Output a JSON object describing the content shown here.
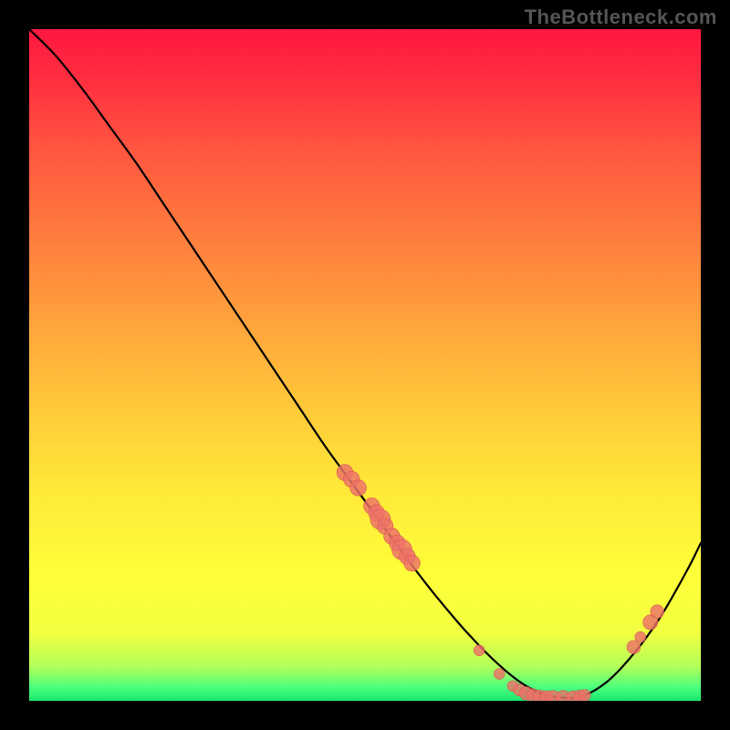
{
  "domain": "Chart",
  "watermark": "TheBottleneck.com",
  "colors": {
    "frame_bg": "#000000",
    "curve_stroke": "#000000",
    "marker_fill": "#ed7169",
    "marker_stroke": "#d85a52",
    "gradient_top": "#ff173f",
    "gradient_mid": "#ffe838",
    "gradient_bottom": "#17e86e"
  },
  "chart_data": {
    "type": "line",
    "title": "",
    "xlabel": "",
    "ylabel": "",
    "xlim": [
      0,
      100
    ],
    "ylim": [
      0,
      100
    ],
    "grid": false,
    "legend": false,
    "curve": {
      "name": "bottleneck-curve",
      "x": [
        0,
        4,
        8,
        12,
        16,
        20,
        24,
        28,
        32,
        36,
        40,
        44,
        48,
        52,
        56,
        60,
        64,
        66,
        68,
        70,
        72,
        74,
        76,
        78,
        82,
        86,
        90,
        94,
        98,
        100
      ],
      "y": [
        100,
        96,
        91,
        85.5,
        80,
        74,
        68,
        62,
        56,
        50,
        44,
        38,
        32.5,
        27,
        21.5,
        16.3,
        11.5,
        9.3,
        7.2,
        5.3,
        3.6,
        2.2,
        1.2,
        0.6,
        0.6,
        2.8,
        7.0,
        12.5,
        19.5,
        23.5
      ]
    },
    "markers": {
      "name": "highlighted-points",
      "points": [
        {
          "x": 47,
          "y": 34,
          "r": 1.2
        },
        {
          "x": 48,
          "y": 33,
          "r": 1.2
        },
        {
          "x": 49,
          "y": 31.7,
          "r": 1.2
        },
        {
          "x": 51,
          "y": 29,
          "r": 1.2
        },
        {
          "x": 51.7,
          "y": 28,
          "r": 1.2
        },
        {
          "x": 52.3,
          "y": 27,
          "r": 1.5
        },
        {
          "x": 53,
          "y": 26,
          "r": 1.2
        },
        {
          "x": 54,
          "y": 24.5,
          "r": 1.2
        },
        {
          "x": 54.8,
          "y": 23.5,
          "r": 1.2
        },
        {
          "x": 55.5,
          "y": 22.5,
          "r": 1.5
        },
        {
          "x": 56.3,
          "y": 21.5,
          "r": 1.2
        },
        {
          "x": 57,
          "y": 20.5,
          "r": 1.2
        },
        {
          "x": 67,
          "y": 7.5,
          "r": 0.8
        },
        {
          "x": 70,
          "y": 4.0,
          "r": 0.8
        },
        {
          "x": 72,
          "y": 2.2,
          "r": 0.8
        },
        {
          "x": 73,
          "y": 1.6,
          "r": 0.9
        },
        {
          "x": 74,
          "y": 1.1,
          "r": 1.0
        },
        {
          "x": 75,
          "y": 0.8,
          "r": 1.0
        },
        {
          "x": 76,
          "y": 0.6,
          "r": 1.0
        },
        {
          "x": 77,
          "y": 0.5,
          "r": 1.0
        },
        {
          "x": 78,
          "y": 0.45,
          "r": 1.1
        },
        {
          "x": 79.5,
          "y": 0.45,
          "r": 1.1
        },
        {
          "x": 81,
          "y": 0.5,
          "r": 1.0
        },
        {
          "x": 82,
          "y": 0.6,
          "r": 1.0
        },
        {
          "x": 82.7,
          "y": 0.8,
          "r": 0.9
        },
        {
          "x": 90,
          "y": 8.0,
          "r": 1.0
        },
        {
          "x": 91,
          "y": 9.5,
          "r": 0.8
        },
        {
          "x": 92.5,
          "y": 11.7,
          "r": 1.1
        },
        {
          "x": 93.5,
          "y": 13.3,
          "r": 1.0
        }
      ]
    }
  }
}
